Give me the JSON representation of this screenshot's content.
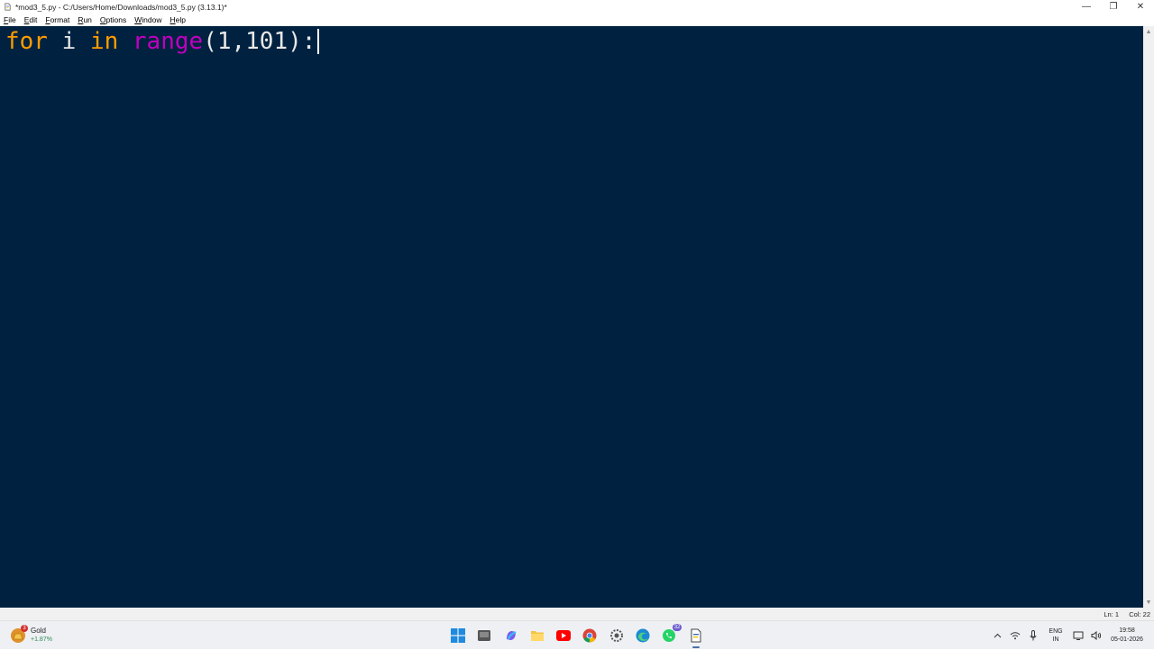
{
  "window": {
    "title": "*mod3_5.py - C:/Users/Home/Downloads/mod3_5.py (3.13.1)*",
    "controls": {
      "minimize": "—",
      "restore": "❐",
      "close": "✕"
    }
  },
  "menu": {
    "items": [
      {
        "first": "F",
        "rest": "ile"
      },
      {
        "first": "E",
        "rest": "dit"
      },
      {
        "first": "F",
        "rest": "ormat"
      },
      {
        "first": "R",
        "rest": "un"
      },
      {
        "first": "O",
        "rest": "ptions"
      },
      {
        "first": "W",
        "rest": "indow"
      },
      {
        "first": "H",
        "rest": "elp"
      }
    ]
  },
  "editor": {
    "background": "#002240",
    "code": {
      "kw_for": "for",
      "var_i": " i ",
      "kw_in": "in",
      "space": " ",
      "builtin_range": "range",
      "args": "(1,101):"
    }
  },
  "status": {
    "line": "Ln: 1",
    "col": "Col: 22"
  },
  "taskbar": {
    "widget": {
      "title": "Gold",
      "change": "+1.87%",
      "badge": "3"
    },
    "apps": [
      "windows-start",
      "desktop",
      "copilot",
      "file-explorer",
      "youtube",
      "chrome",
      "settings",
      "edge",
      "whatsapp",
      "python-idle"
    ],
    "whatsapp_badge": "32",
    "language": {
      "line1": "ENG",
      "line2": "IN"
    },
    "clock": {
      "time": "19:58",
      "date": "05-01-2026"
    }
  }
}
